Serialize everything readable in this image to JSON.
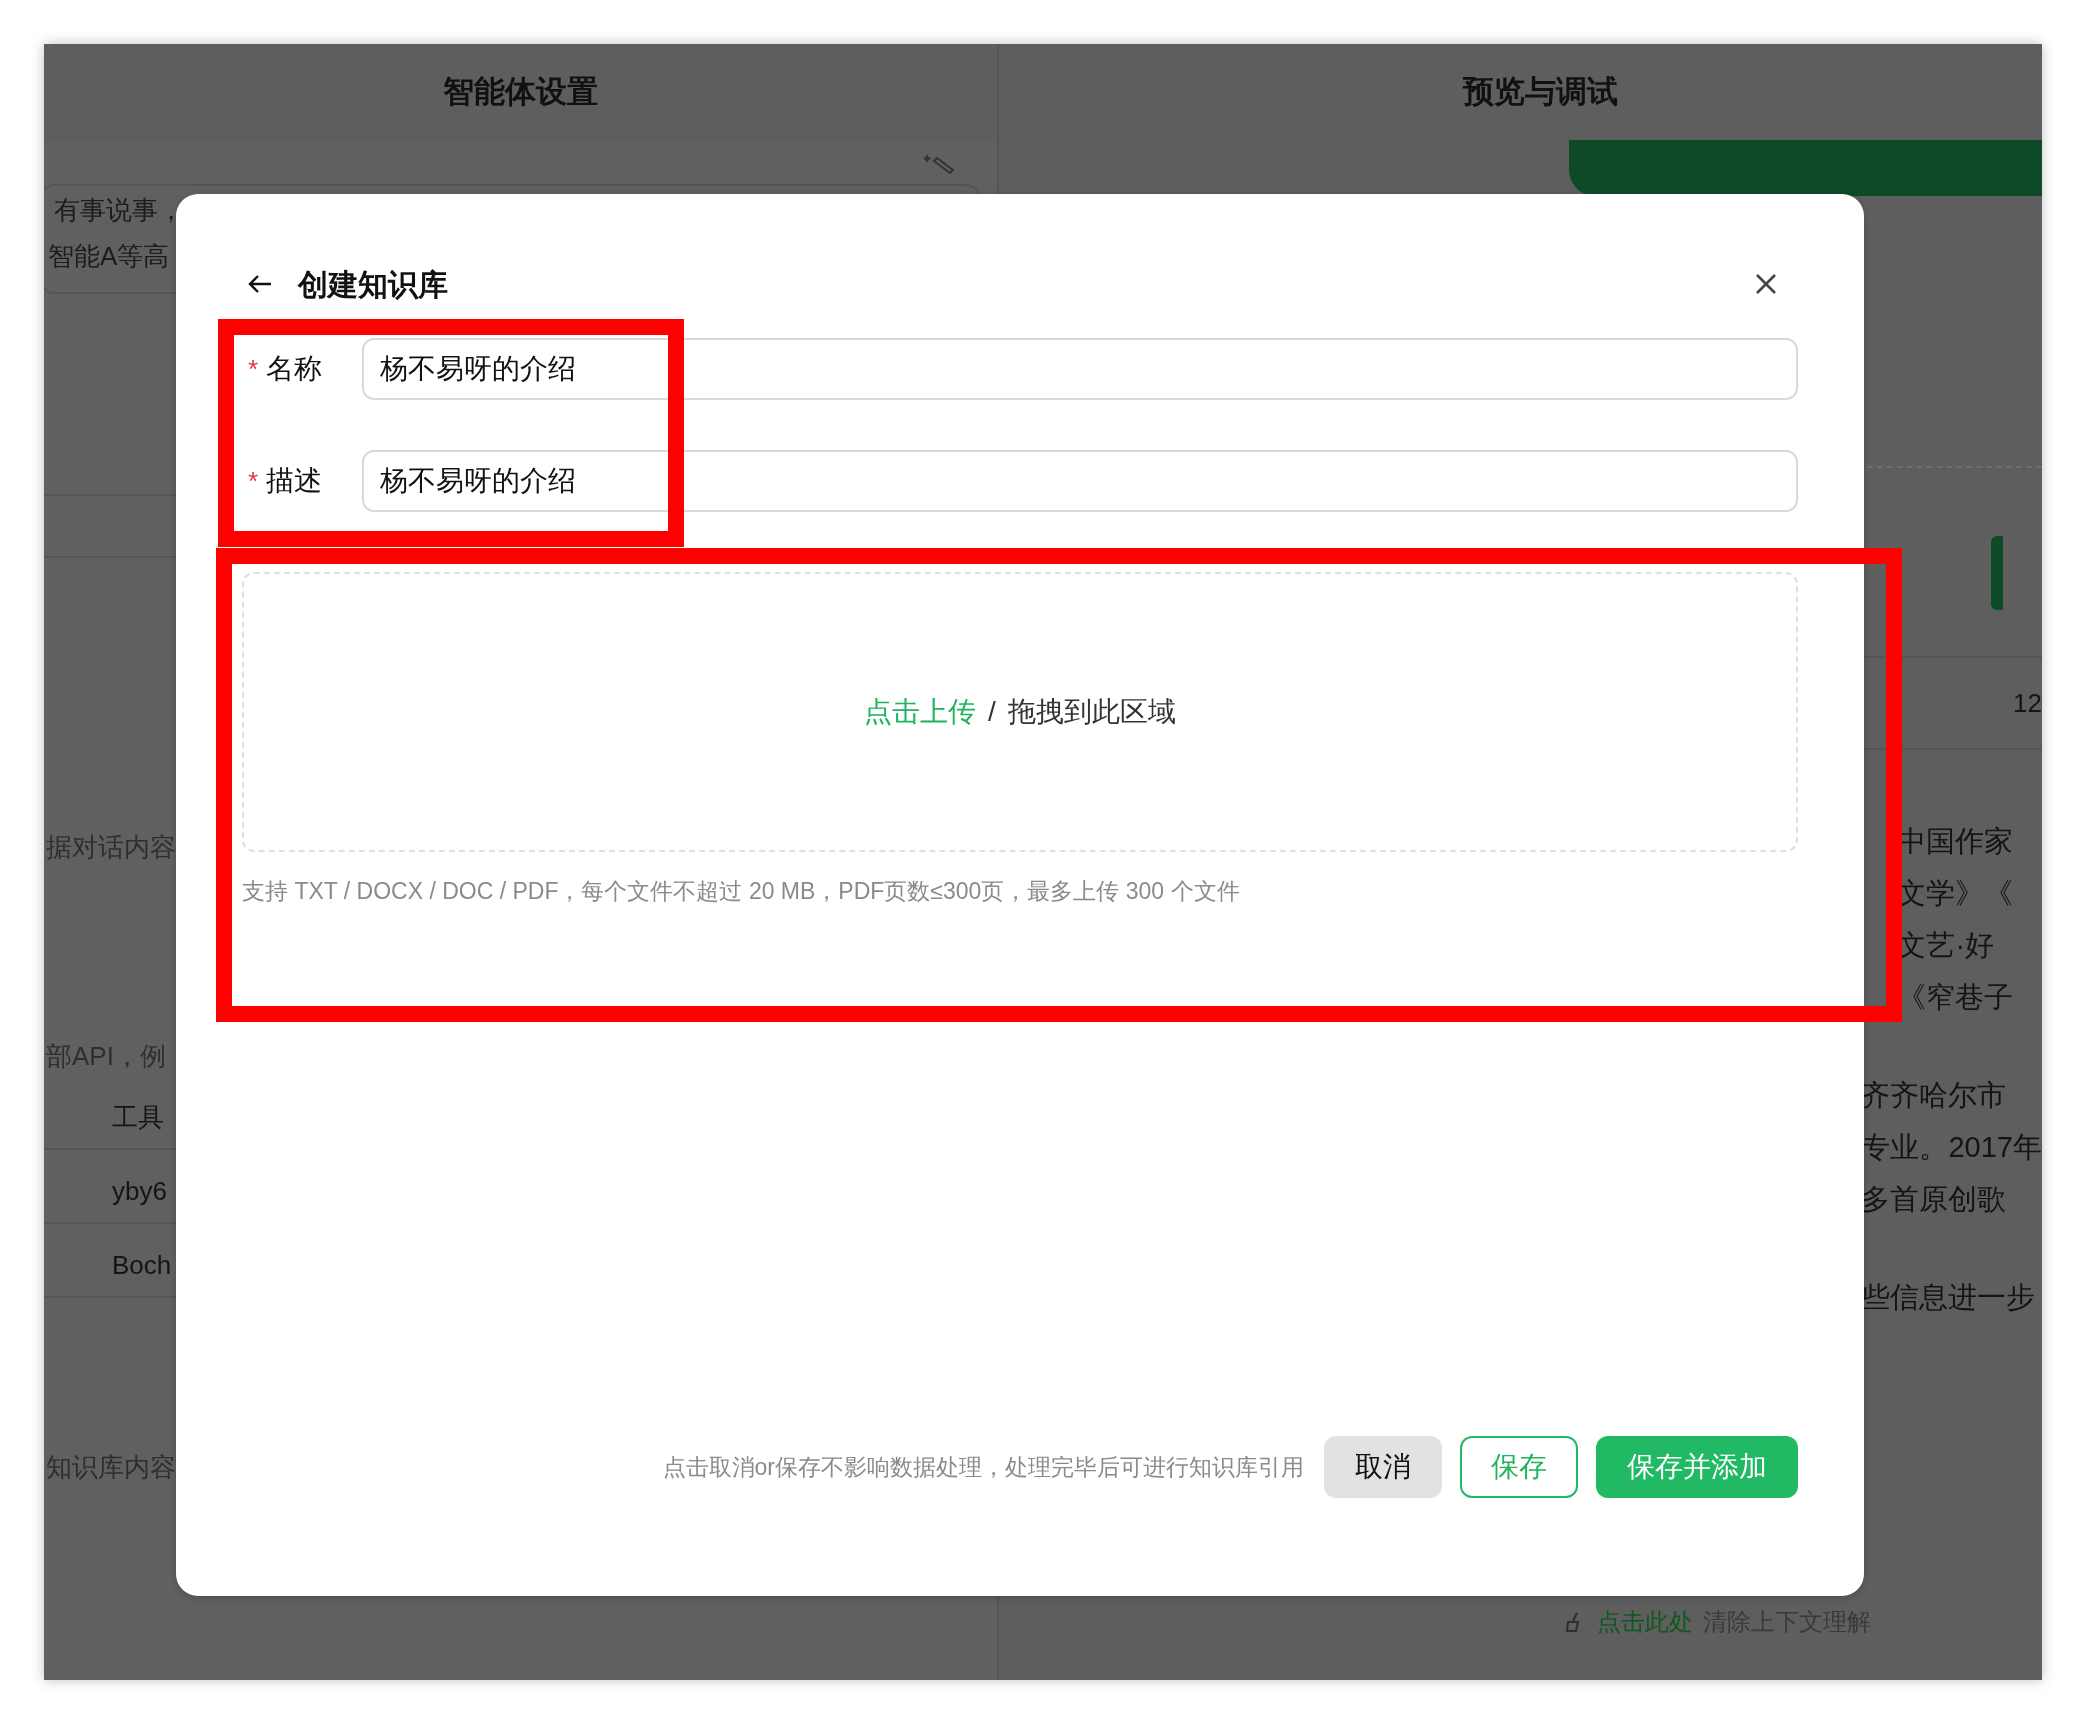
{
  "background": {
    "left_panel": {
      "title": "智能体设置",
      "items": [
        {
          "kind": "textarea",
          "lines": [
            "有事说事，",
            "智能A等高"
          ]
        },
        {
          "kind": "hint",
          "text": "据对话内容"
        },
        {
          "kind": "hint",
          "text": "部API，例"
        },
        {
          "kind": "row",
          "text": "工具"
        },
        {
          "kind": "row",
          "text": "yby6"
        },
        {
          "kind": "row",
          "text": "Boch"
        },
        {
          "kind": "hint",
          "text": "知识库内容"
        }
      ]
    },
    "right_panel": {
      "title": "预览与调试",
      "count": "12",
      "paragraphs": [
        [
          "中国作家",
          "文学》《",
          "文艺·好",
          "《窄巷子"
        ],
        [
          "齐齐哈尔市",
          "专业。2017年",
          "多首原创歌"
        ],
        [
          "些信息进一步"
        ]
      ],
      "clear_link": {
        "link": "点击此处",
        "text": "清除上下文理解"
      }
    }
  },
  "dialog": {
    "title": "创建知识库",
    "fields": [
      {
        "required_mark": "*",
        "label": "名称",
        "value": "杨不易呀的介绍"
      },
      {
        "required_mark": "*",
        "label": "描述",
        "value": "杨不易呀的介绍"
      }
    ],
    "upload": {
      "link": "点击上传",
      "separator": "/",
      "text": "拖拽到此区域",
      "hint": "支持 TXT / DOCX / DOC / PDF，每个文件不超过 20 MB，PDF页数≤300页，最多上传 300 个文件"
    },
    "footer_note": "点击取消or保存不影响数据处理，处理完毕后可进行知识库引用",
    "buttons": [
      {
        "kind": "secondary",
        "label": "取消"
      },
      {
        "kind": "outline",
        "label": "保存"
      },
      {
        "kind": "primary",
        "label": "保存并添加"
      }
    ]
  },
  "annotations": [
    {
      "kind": "box",
      "color": "#ff0000"
    },
    {
      "kind": "box",
      "color": "#ff0000"
    }
  ]
}
